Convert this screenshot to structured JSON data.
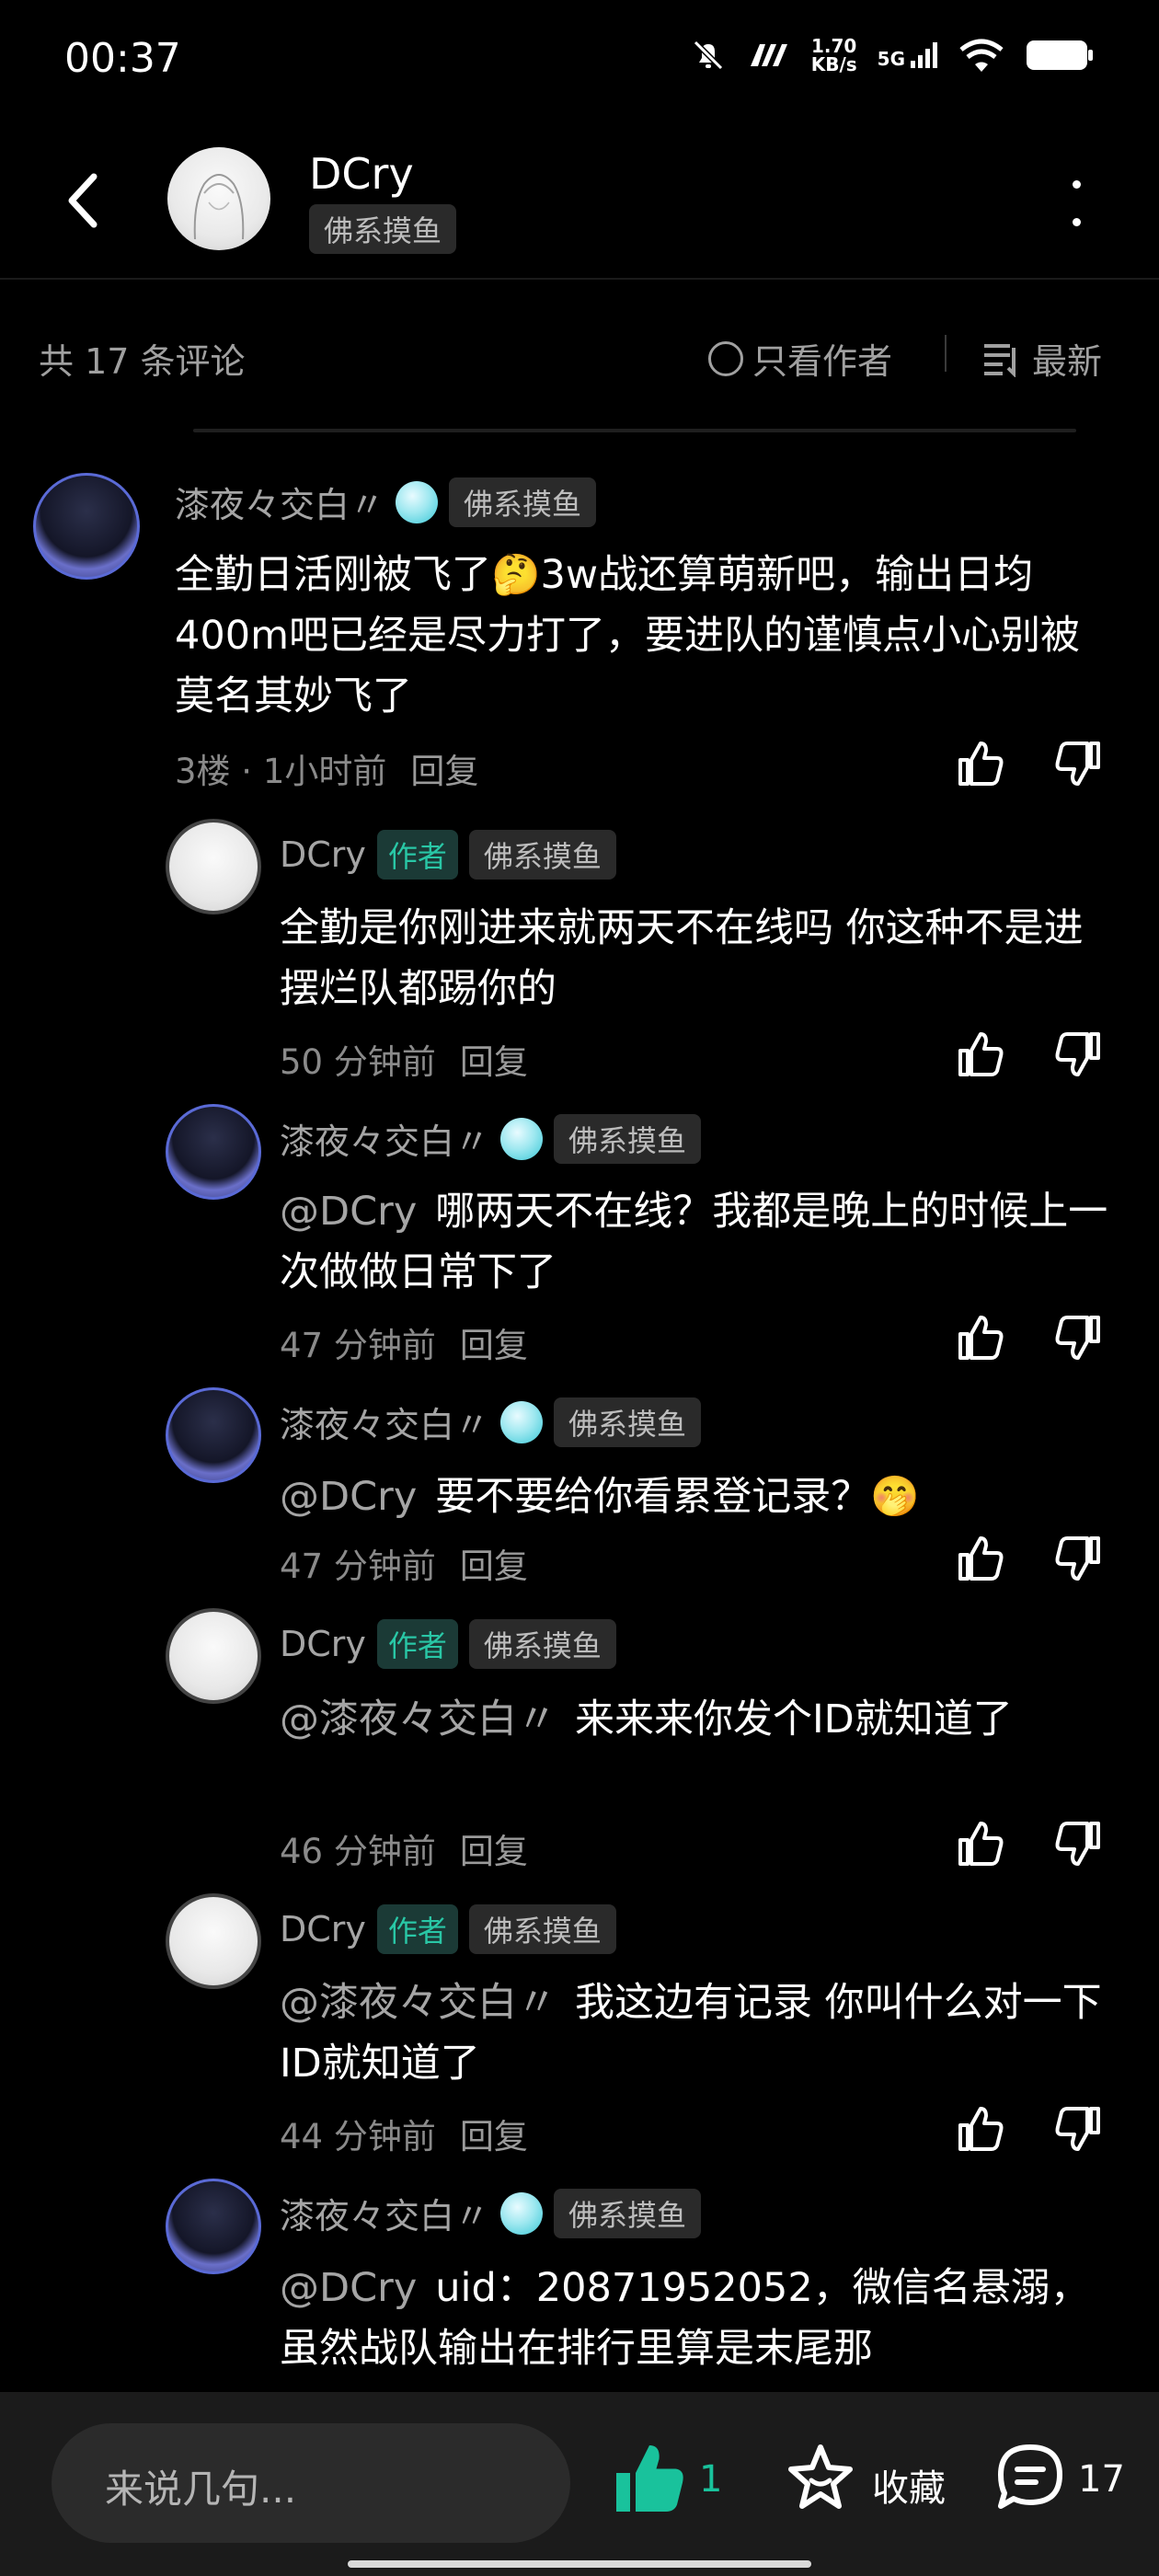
{
  "status_bar": {
    "time": "00:37",
    "net_speed_value": "1.70",
    "net_speed_unit": "KB/s",
    "signal_label": "5G"
  },
  "header": {
    "title": "DCry",
    "tag": "佛系摸鱼"
  },
  "filter_bar": {
    "count": "共 17 条评论",
    "only_author": "只看作者",
    "sort": "最新"
  },
  "comments": [
    {
      "name": "漆夜々交白〃",
      "tag": "佛系摸鱼",
      "text": "全勤日活刚被飞了🤔3w战还算萌新吧，输出日均400m吧已经是尽力打了，要进队的谨慎点小心别被莫名其妙飞了",
      "meta": "3楼 · 1小时前",
      "reply": "回复"
    },
    {
      "name": "DCry",
      "badge": "作者",
      "tag": "佛系摸鱼",
      "text": "全勤是你刚进来就两天不在线吗 你这种不是进摆烂队都踢你的",
      "meta": "50 分钟前",
      "reply": "回复"
    },
    {
      "name": "漆夜々交白〃",
      "tag": "佛系摸鱼",
      "mention": "@DCry",
      "text": "哪两天不在线？我都是晚上的时候上一次做做日常下了",
      "meta": "47 分钟前",
      "reply": "回复"
    },
    {
      "name": "漆夜々交白〃",
      "tag": "佛系摸鱼",
      "mention": "@DCry",
      "text": "要不要给你看累登记录？🤭",
      "meta": "47 分钟前",
      "reply": "回复"
    },
    {
      "name": "DCry",
      "badge": "作者",
      "tag": "佛系摸鱼",
      "mention": "@漆夜々交白〃",
      "text": "来来来你发个ID就知道了",
      "meta": "46 分钟前",
      "reply": "回复"
    },
    {
      "name": "DCry",
      "badge": "作者",
      "tag": "佛系摸鱼",
      "mention": "@漆夜々交白〃",
      "text": "我这边有记录 你叫什么对一下ID就知道了",
      "meta": "44 分钟前",
      "reply": "回复"
    },
    {
      "name": "漆夜々交白〃",
      "tag": "佛系摸鱼",
      "mention": "@DCry",
      "text": "uid：20871952052，微信名悬溺，虽然战队输出在排行里算是末尾那"
    }
  ],
  "bottom_bar": {
    "input_placeholder": "来说几句...",
    "like_count": "1",
    "favorite_label": "收藏",
    "comment_count": "17"
  },
  "colors": {
    "background": "#000000",
    "accent": "#19c29c",
    "muted_text": "#a5a5a5",
    "author_badge_bg": "#1b3a36"
  }
}
